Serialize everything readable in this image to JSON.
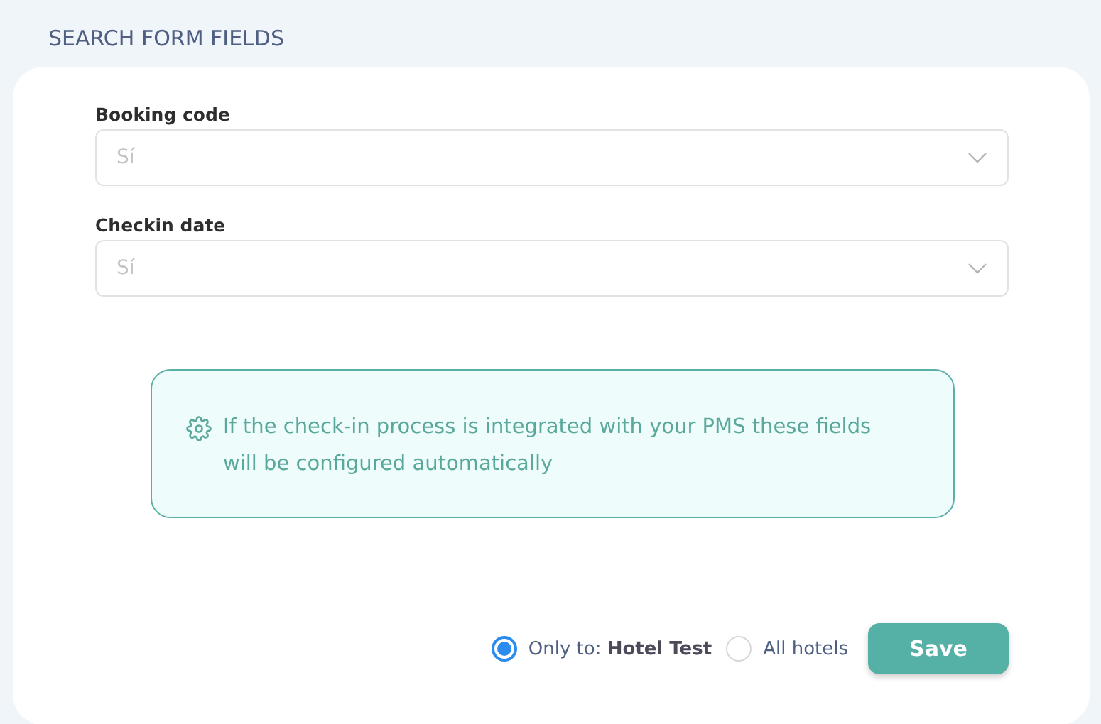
{
  "section_title": "SEARCH FORM FIELDS",
  "fields": [
    {
      "label": "Booking code",
      "placeholder": "Sí"
    },
    {
      "label": "Checkin date",
      "placeholder": "Sí"
    }
  ],
  "info": {
    "text": "If the check-in process is integrated with your PMS these fields will be configured automatically"
  },
  "scope_options": [
    {
      "label": "Only to: **Hotel Test**",
      "selected": true
    },
    {
      "label": "All hotels",
      "selected": false
    }
  ],
  "save_button": "Save"
}
